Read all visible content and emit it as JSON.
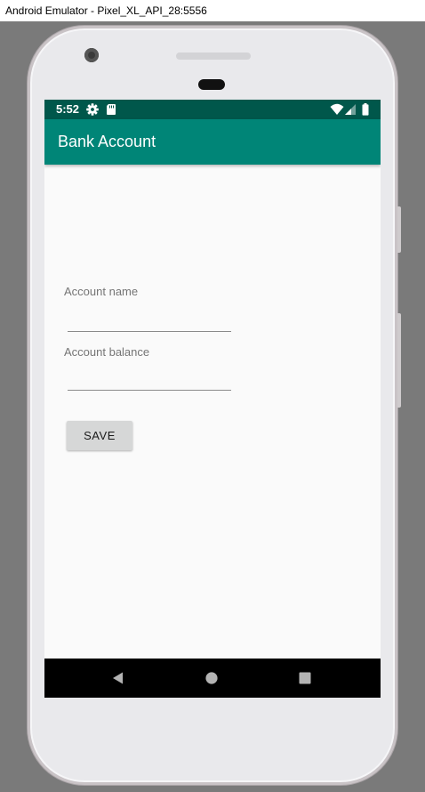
{
  "window": {
    "title": "Android Emulator - Pixel_XL_API_28:5556"
  },
  "status_bar": {
    "time": "5:52",
    "icons": [
      "gear-icon",
      "sd-card-icon",
      "wifi-icon",
      "signal-icon",
      "battery-icon"
    ]
  },
  "app_bar": {
    "title": "Bank Account"
  },
  "form": {
    "account_name": {
      "label": "Account name",
      "value": ""
    },
    "account_balance": {
      "label": "Account balance",
      "value": ""
    },
    "save_label": "SAVE"
  },
  "nav_bar": {
    "buttons": [
      "back-icon",
      "home-icon",
      "recents-icon"
    ]
  },
  "colors": {
    "primary": "#008577",
    "primary_dark": "#00574B",
    "background": "#FAFAFA",
    "button": "#D6D7D7"
  }
}
